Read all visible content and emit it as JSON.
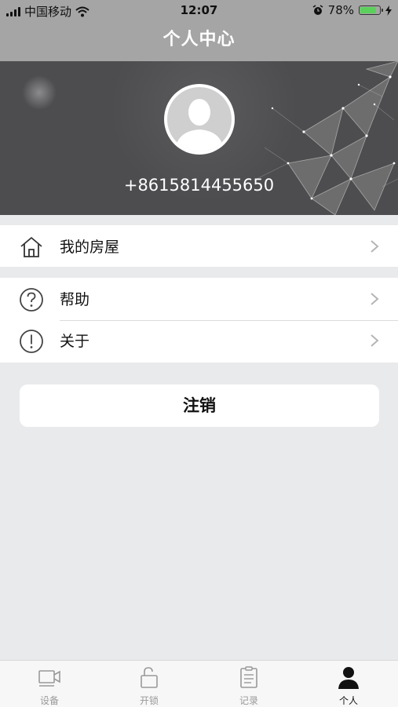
{
  "status_bar": {
    "carrier": "中国移动",
    "time": "12:07",
    "battery_percent": "78%",
    "battery_level": 0.78,
    "icons": [
      "signal-icon",
      "wifi-icon",
      "alarm-icon",
      "battery-icon",
      "charging-icon"
    ]
  },
  "nav": {
    "title": "个人中心"
  },
  "profile": {
    "phone": "+8615814455650",
    "avatar_icon": "default-avatar-icon"
  },
  "menu_group1": [
    {
      "label": "我的房屋",
      "icon": "house-icon"
    }
  ],
  "menu_group2": [
    {
      "label": "帮助",
      "icon": "question-circle-icon"
    },
    {
      "label": "关于",
      "icon": "exclamation-circle-icon"
    }
  ],
  "logout_label": "注销",
  "tabbar": {
    "tabs": [
      {
        "label": "设备",
        "icon": "camera-icon",
        "active": false
      },
      {
        "label": "开锁",
        "icon": "unlock-icon",
        "active": false
      },
      {
        "label": "记录",
        "icon": "clipboard-icon",
        "active": false
      },
      {
        "label": "个人",
        "icon": "person-icon",
        "active": true
      }
    ]
  },
  "colors": {
    "header_gray": "#a5a5a5",
    "hero_dark": "#4d4d4f",
    "page_bg": "#e9eaec",
    "battery_green": "#5bd15b",
    "tab_inactive": "#999999",
    "tab_active": "#111111"
  }
}
